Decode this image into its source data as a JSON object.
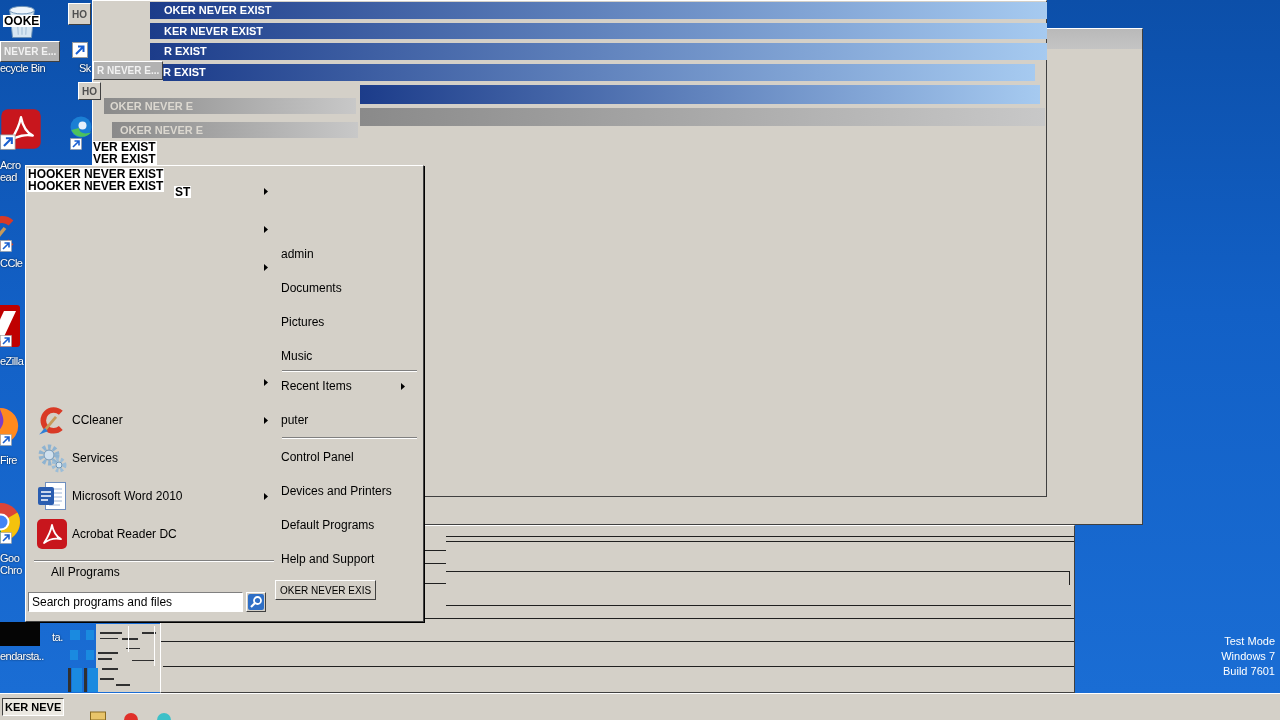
{
  "desktop_icons": [
    {
      "kind": "recycle-bin",
      "lines": [
        "ecycle Bin"
      ]
    },
    {
      "kind": "pdf",
      "lines": [
        "Acro",
        "ead"
      ]
    },
    {
      "kind": "cleaner",
      "lines": [
        "CCle"
      ]
    },
    {
      "kind": "filezilla",
      "lines": [
        "eZilla"
      ]
    },
    {
      "kind": "firefox",
      "lines": [
        "Fire"
      ]
    },
    {
      "kind": "chrome",
      "lines": [
        "Goo",
        "Chro"
      ]
    },
    {
      "kind": "skype",
      "lines": [
        "Sk"
      ]
    },
    {
      "kind": "edge"
    },
    {
      "kind": "blank",
      "lines": [
        "ta."
      ]
    },
    {
      "kind": "dark-tile",
      "lines": [
        "endarsta.."
      ]
    }
  ],
  "window_stack": [
    {
      "title": "OKER NEVER EXIST",
      "active": true
    },
    {
      "title": "KER NEVER EXIST",
      "active": true
    },
    {
      "title": "R EXIST",
      "active": true
    },
    {
      "title": "R EXIST",
      "active": true
    },
    {
      "active": true
    },
    {
      "title": "OKER NEVER E",
      "active": false
    },
    {
      "active": false
    },
    {
      "title": "OKER NEVER E",
      "active": false
    }
  ],
  "minimized_windows": [
    {
      "label": "HO",
      "disabled": false
    },
    {
      "label": "NEVER E...",
      "disabled": true
    },
    {
      "label": "R NEVER E...",
      "disabled": true
    },
    {
      "label": "HO",
      "disabled": false
    }
  ],
  "title_fragments": [
    "OOKE",
    "VER EXIST",
    "VER EXIST",
    "HOOKER NEVER EXIST",
    "HOOKER NEVER EXIST",
    "ST"
  ],
  "start_menu": {
    "pinned": [
      {
        "submenu": true
      },
      {
        "submenu": true
      },
      {
        "submenu": true
      }
    ],
    "recent": [
      {
        "submenu": true
      },
      {
        "kind": "cleaner",
        "label": "CCleaner",
        "submenu": true
      },
      {
        "kind": "services",
        "label": "Services",
        "submenu": false
      },
      {
        "kind": "word",
        "label": "Microsoft Word 2010",
        "submenu": true
      },
      {
        "kind": "pdf",
        "label": "Acrobat Reader DC",
        "submenu": false
      }
    ],
    "all_programs": "All Programs",
    "search": {
      "placeholder": "Search programs and files"
    },
    "place_groups": [
      {
        "items": [
          {
            "label": "admin",
            "submenu": false
          },
          {
            "label": "Documents",
            "submenu": false
          },
          {
            "label": "Pictures",
            "submenu": false
          },
          {
            "label": "Music",
            "submenu": false
          }
        ]
      },
      {
        "items": [
          {
            "label": "Recent Items",
            "submenu": true
          },
          {
            "label": "puter",
            "submenu": false
          }
        ]
      },
      {
        "items": [
          {
            "label": "Control Panel",
            "submenu": false
          },
          {
            "label": "Devices and Printers",
            "submenu": false
          },
          {
            "label": "Default Programs",
            "submenu": false
          },
          {
            "label": "Help and Support",
            "submenu": false
          }
        ]
      }
    ],
    "shutdown": {
      "label": "OKER NEVER EXIS"
    }
  },
  "taskbar": {
    "buttons": [
      {
        "label": "KER NEVE"
      }
    ]
  },
  "test_mode_text": [
    "Test Mode",
    "Windows 7",
    "Build 7601"
  ]
}
